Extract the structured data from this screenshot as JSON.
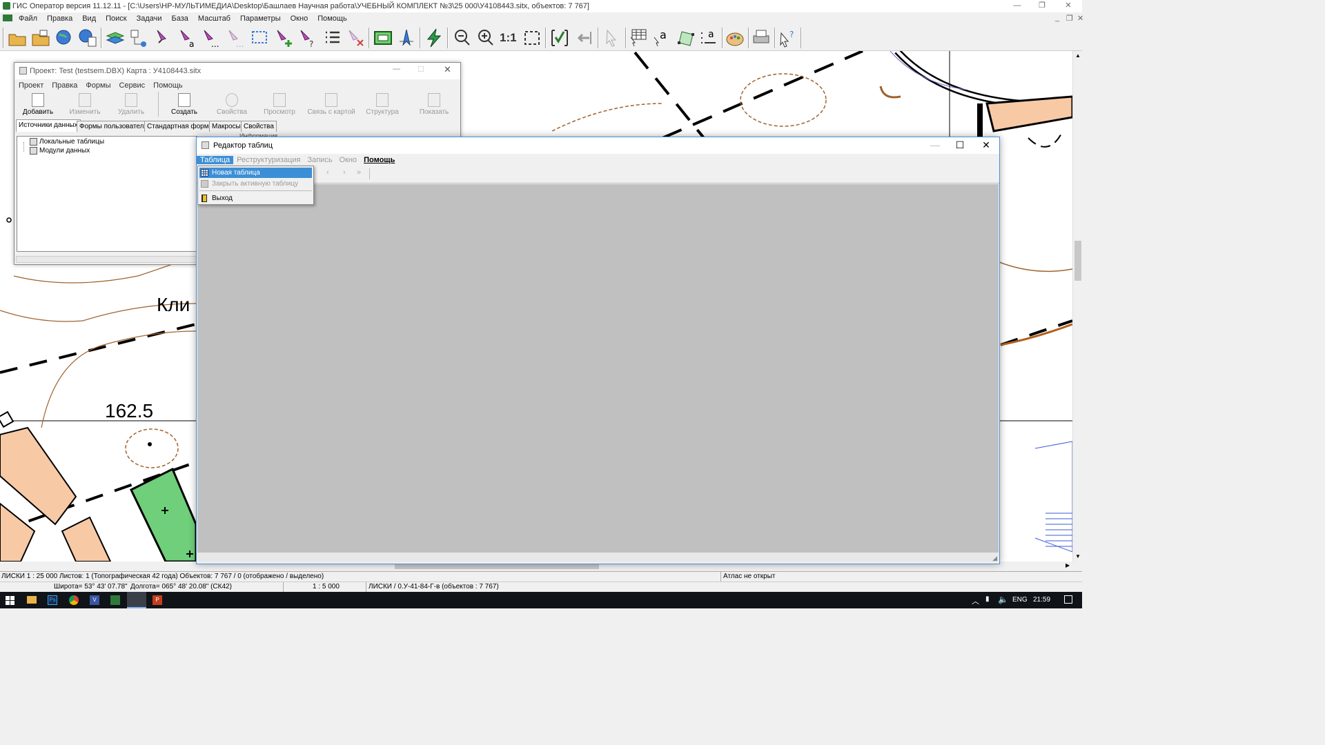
{
  "app": {
    "title": "ГИС Оператор версия 11.12.11 - [C:\\Users\\HP-МУЛЬТИМЕДИА\\Desktop\\Башлаев Научная работа\\УЧЕБНЫЙ КОМПЛЕКТ №3\\25 000\\У4108443.sitx, объектов: 7 767]",
    "menu": [
      "Файл",
      "Правка",
      "Вид",
      "Поиск",
      "Задачи",
      "База",
      "Масштаб",
      "Параметры",
      "Окно",
      "Помощь"
    ],
    "toolbar_scale_label": "1:1"
  },
  "map": {
    "labels": [
      "Кли",
      "162.5"
    ]
  },
  "project_window": {
    "title": "Проект: Test (testsem.DBX)  Карта : У4108443.sitx",
    "menu": [
      "Проект",
      "Правка",
      "Формы",
      "Сервис",
      "Помощь"
    ],
    "buttons": [
      {
        "label": "Добавить",
        "enabled": true
      },
      {
        "label": "Изменить",
        "enabled": false
      },
      {
        "label": "Удалить",
        "enabled": false
      },
      {
        "label": "Создать",
        "enabled": true
      },
      {
        "label": "Свойства",
        "enabled": false
      },
      {
        "label": "Просмотр",
        "enabled": false
      },
      {
        "label": "Связь с картой",
        "enabled": false
      },
      {
        "label": "Структура",
        "enabled": false
      },
      {
        "label": "Показать",
        "enabled": false
      }
    ],
    "tabs": [
      "Источники данных",
      "Формы пользователя",
      "Стандартная форма",
      "Макросы",
      "Свойства"
    ],
    "tree": [
      "Локальные таблицы",
      "Модули данных"
    ],
    "partial_label": "Информация"
  },
  "table_editor": {
    "title": "Редактор таблиц",
    "menu": [
      {
        "label": "Таблица",
        "state": "active"
      },
      {
        "label": "Реструктуризация",
        "state": "disabled"
      },
      {
        "label": "Запись",
        "state": "disabled"
      },
      {
        "label": "Окно",
        "state": "disabled"
      },
      {
        "label": "Помощь",
        "state": "normal"
      }
    ],
    "dropdown": [
      {
        "label": "Новая таблица",
        "state": "highlighted"
      },
      {
        "label": "Закрыть активную таблицу",
        "state": "disabled"
      },
      {
        "label": "Выход",
        "state": "normal"
      }
    ]
  },
  "status": {
    "line1_left": "ЛИСКИ  1 : 25 000  Листов: 1   (Топографическая 42 года)  Объектов: 7 767 / 0  (отображено / выделено)",
    "line1_right": "Атлас не открыт",
    "latitude": "Широта= 53° 43' 07.78\"",
    "longitude": "Долгота= 065° 48' 20.08\"  (СК42)",
    "scale": "1 : 5 000",
    "sheet": "ЛИСКИ / 0.У-41-84-Г-в   (объектов : 7 767)"
  },
  "taskbar": {
    "lang": "ENG",
    "time": "21:59"
  }
}
